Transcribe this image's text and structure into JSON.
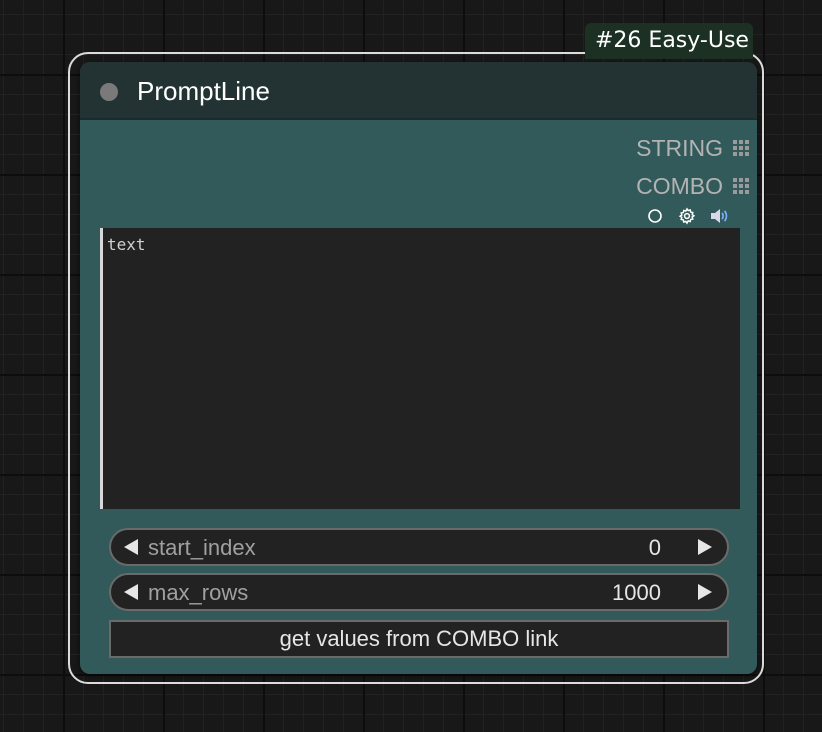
{
  "badge": {
    "text": "#26 Easy-Use"
  },
  "node": {
    "title": "PromptLine",
    "outputs": [
      {
        "label": "STRING"
      },
      {
        "label": "COMBO"
      }
    ],
    "toolbar_icons": [
      "circle-icon",
      "gear-icon",
      "speaker-icon"
    ],
    "text_widget": {
      "placeholder": "text",
      "value": ""
    },
    "widgets": {
      "start_index": {
        "label": "start_index",
        "value": "0"
      },
      "max_rows": {
        "label": "max_rows",
        "value": "1000"
      }
    },
    "button": {
      "label": "get values from COMBO link"
    }
  },
  "colors": {
    "node_body": "#335a5a",
    "node_header": "#233333",
    "badge_bg": "#1d3024",
    "widget_bg": "#222222",
    "canvas_bg": "#181818"
  }
}
